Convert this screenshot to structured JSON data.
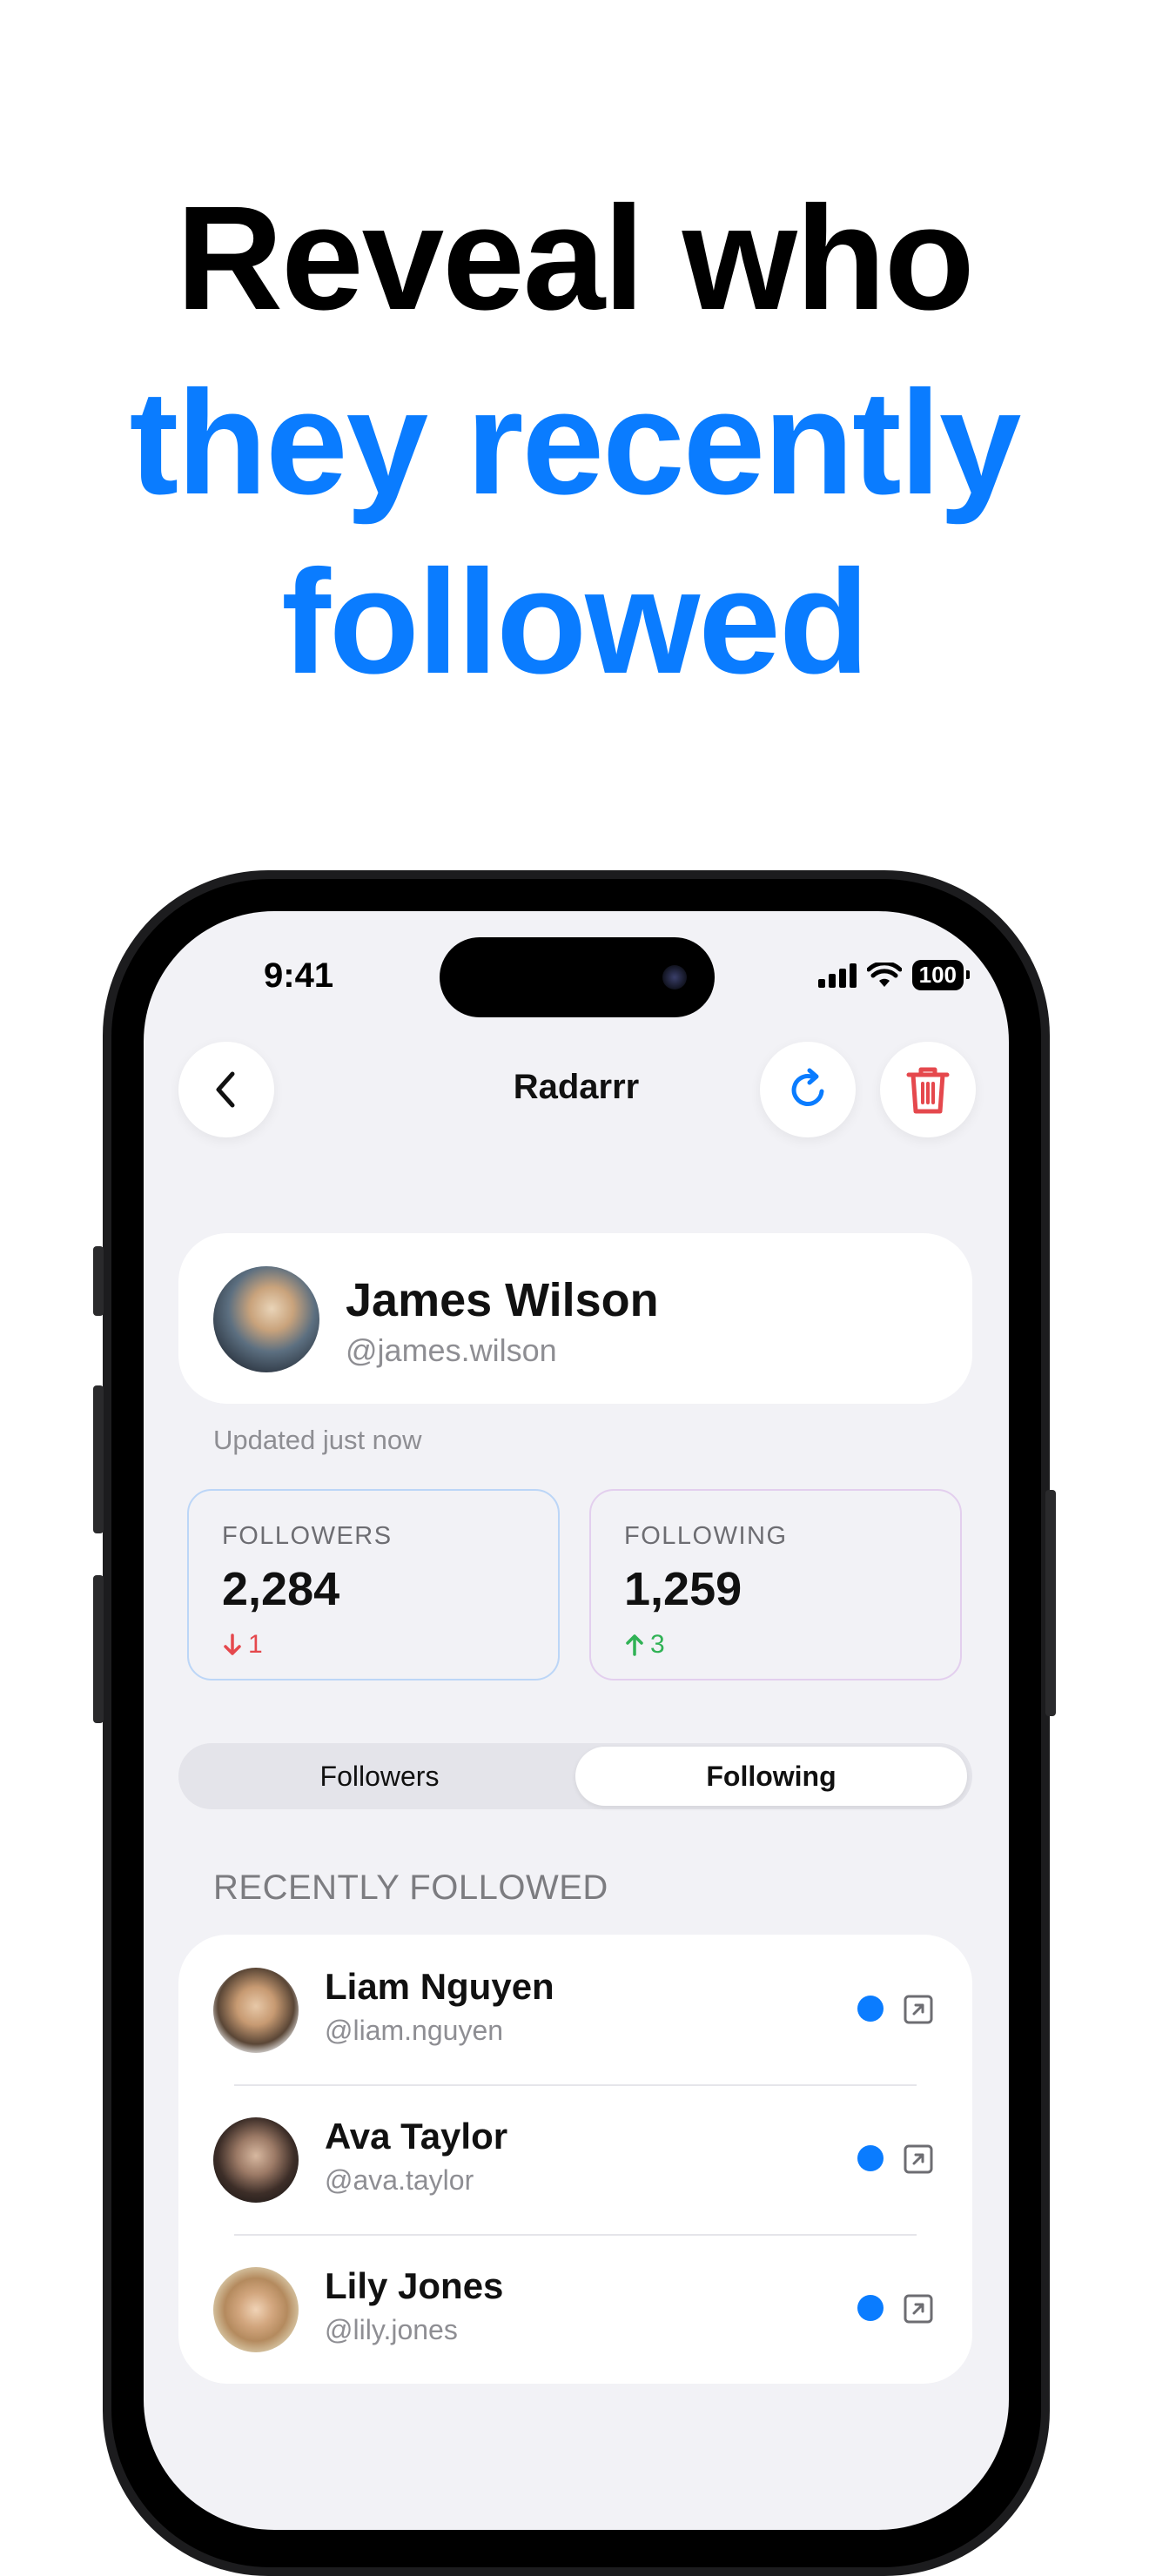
{
  "headline": {
    "line1": "Reveal who",
    "line2": "they recently",
    "line3": "followed"
  },
  "status_bar": {
    "time": "9:41",
    "battery": "100"
  },
  "nav": {
    "title": "Radarrr"
  },
  "profile": {
    "name": "James Wilson",
    "handle": "@james.wilson",
    "updated": "Updated just now"
  },
  "stats": {
    "followers": {
      "label": "FOLLOWERS",
      "value": "2,284",
      "delta": "1",
      "direction": "down",
      "color": "#e5484d",
      "border": "#bcd6f7"
    },
    "following": {
      "label": "FOLLOWING",
      "value": "1,259",
      "delta": "3",
      "direction": "up",
      "color": "#30b255",
      "border": "#e3cfee"
    }
  },
  "segment": {
    "options": [
      "Followers",
      "Following"
    ],
    "selected": "Following"
  },
  "section": {
    "title": "RECENTLY FOLLOWED"
  },
  "list": [
    {
      "name": "Liam Nguyen",
      "handle": "@liam.nguyen"
    },
    {
      "name": "Ava Taylor",
      "handle": "@ava.taylor"
    },
    {
      "name": "Lily Jones",
      "handle": "@lily.jones"
    }
  ],
  "colors": {
    "accent": "#0a7cff",
    "danger": "#e5484d",
    "background": "#f2f2f6"
  },
  "icons": [
    "back-chevron-icon",
    "refresh-icon",
    "trash-icon",
    "arrow-down-icon",
    "arrow-up-icon",
    "external-link-icon",
    "unread-dot-icon"
  ]
}
